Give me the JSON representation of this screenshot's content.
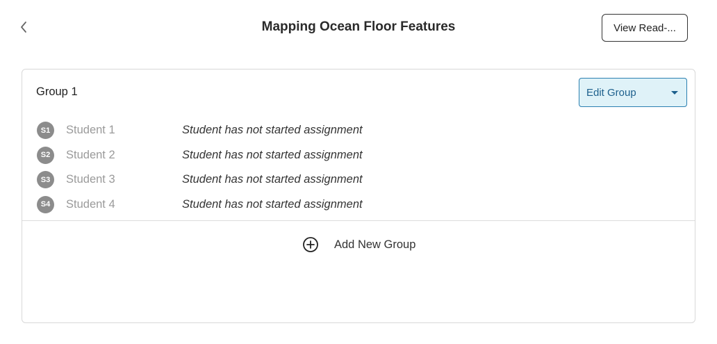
{
  "header": {
    "back_icon": "chevron-left-icon",
    "title": "Mapping Ocean Floor Features",
    "view_read_label": "View Read-..."
  },
  "group": {
    "title": "Group 1",
    "edit_label": "Edit Group",
    "students": [
      {
        "initials": "S1",
        "name": "Student 1",
        "status": "Student has not started assignment"
      },
      {
        "initials": "S2",
        "name": "Student 2",
        "status": "Student has not started assignment"
      },
      {
        "initials": "S3",
        "name": "Student 3",
        "status": "Student has not started assignment"
      },
      {
        "initials": "S4",
        "name": "Student 4",
        "status": "Student has not started assignment"
      }
    ]
  },
  "add_group": {
    "icon": "plus-circle-icon",
    "label": "Add New Group"
  },
  "colors": {
    "accent": "#1c5f8c",
    "accent_bg": "#dff2f8",
    "avatar_bg": "#8c8c8c"
  }
}
